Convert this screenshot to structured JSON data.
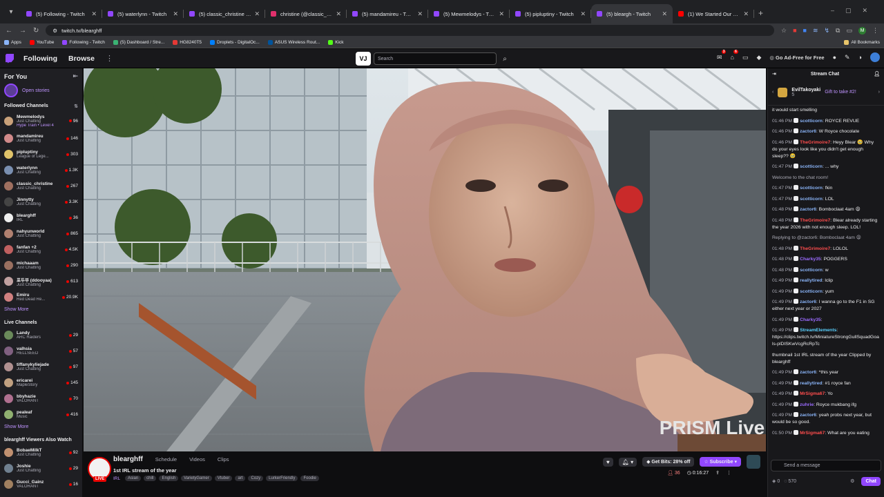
{
  "browser": {
    "tabs": [
      {
        "title": "(5) Following - Twitch",
        "color": "#9147ff"
      },
      {
        "title": "(5) waterlynn - Twitch",
        "color": "#9147ff"
      },
      {
        "title": "(5) classic_christine - Twitch",
        "color": "#9147ff"
      },
      {
        "title": "christine (@classic_christine) -",
        "color": "#e1306c"
      },
      {
        "title": "(5) mandamireu - Twitch",
        "color": "#9147ff"
      },
      {
        "title": "(5) Mewmelodys - Twitch",
        "color": "#9147ff"
      },
      {
        "title": "(5) pipluptiny - Twitch",
        "color": "#9147ff"
      },
      {
        "title": "(5) bleargh - Twitch",
        "color": "#9147ff",
        "active": true
      },
      {
        "title": "(1) We Started Our Own Food",
        "color": "#ff0000"
      }
    ],
    "url": "twitch.tv/blearghff",
    "bookmarks": [
      {
        "label": "Apps",
        "color": "#8ab4f8"
      },
      {
        "label": "YouTube",
        "color": "#ff0000"
      },
      {
        "label": "Following - Twitch",
        "color": "#9147ff"
      },
      {
        "label": "(5) Dashboard / Stre...",
        "color": "#3bb273"
      },
      {
        "label": "HG8240T5",
        "color": "#e53935"
      },
      {
        "label": "Droplets - DigitalOc...",
        "color": "#0080ff"
      },
      {
        "label": "ASUS Wireless Rout...",
        "color": "#00539b"
      },
      {
        "label": "Kick",
        "color": "#53fc18"
      }
    ],
    "all_bookmarks": "All Bookmarks",
    "profile_initial": "M"
  },
  "topnav": {
    "following": "Following",
    "browse": "Browse",
    "vj": "VJ",
    "search_placeholder": "Search",
    "notif_count_1": "3",
    "notif_count_2": "6",
    "ad_free": "Go Ad-Free for Free"
  },
  "sidebar": {
    "for_you": "For You",
    "open_stories": "Open stories",
    "followed_title": "Followed Channels",
    "followed": [
      {
        "name": "Mewmelodys",
        "sub": "Just Chatting",
        "extra": "Hype Train • Level 4",
        "count": "96",
        "color": "#c9a17a"
      },
      {
        "name": "mandamireu",
        "sub": "Just Chatting",
        "count": "146",
        "color": "#d18a8a"
      },
      {
        "name": "pipluptiny",
        "sub": "League of Lege...",
        "count": "303",
        "color": "#e0c36a"
      },
      {
        "name": "waterlynn",
        "sub": "Just Chatting",
        "count": "1.3K",
        "color": "#7a8fb0"
      },
      {
        "name": "classic_christine",
        "sub": "Just Chatting",
        "count": "267",
        "color": "#a07060"
      },
      {
        "name": "Jinnytty",
        "sub": "Just Chatting",
        "count": "3.3K",
        "color": "#444444"
      },
      {
        "name": "blearghff",
        "sub": "IRL",
        "count": "36",
        "color": "#eeeeee"
      },
      {
        "name": "nahyunworld",
        "sub": "Just Chatting",
        "count": "865",
        "color": "#b08070"
      },
      {
        "name": "fanfan +2",
        "sub": "Just Chatting",
        "count": "4.5K",
        "color": "#c06060"
      },
      {
        "name": "michaaam",
        "sub": "Just Chatting",
        "count": "290",
        "color": "#9a7060"
      },
      {
        "name": "포두부 (ddooyaa)",
        "sub": "Just Chatting",
        "count": "613",
        "color": "#c0a0a0"
      },
      {
        "name": "Emiru",
        "sub": "Red Dead Re...",
        "count": "20.9K",
        "color": "#d08080"
      }
    ],
    "show_more_1": "Show More",
    "live_title": "Live Channels",
    "live": [
      {
        "name": "Landy",
        "sub": "ARC Raiders",
        "count": "29",
        "color": "#6a8a5a"
      },
      {
        "name": "valhsia",
        "sub": "HELLSEED",
        "count": "57",
        "color": "#806080"
      },
      {
        "name": "tiffanykyliejade",
        "sub": "Just Chatting",
        "count": "97",
        "color": "#b09090"
      },
      {
        "name": "ericarei",
        "sub": "MapleStory",
        "count": "145",
        "color": "#c0a080"
      },
      {
        "name": "bbyhazie",
        "sub": "VALORANT",
        "count": "70",
        "color": "#b07090"
      },
      {
        "name": "pealeaf",
        "sub": "Music",
        "count": "416",
        "color": "#90b070"
      }
    ],
    "show_more_2": "Show More",
    "also_title": "blearghff Viewers Also Watch",
    "also": [
      {
        "name": "BobaeMilkT",
        "sub": "Just Chatting",
        "count": "92",
        "color": "#c09070"
      },
      {
        "name": "Joshie",
        "sub": "Just Chatting",
        "count": "29",
        "color": "#708090"
      },
      {
        "name": "Gucci_Gainz",
        "sub": "VALORANT",
        "count": "16",
        "color": "#a08060"
      }
    ]
  },
  "video": {
    "watermark": "PRISM Live"
  },
  "stream": {
    "channel": "blearghff",
    "title": "1st IRL stream of the year",
    "live": "LIVE",
    "schedule": "Schedule",
    "videos": "Videos",
    "clips": "Clips",
    "category": "IRL",
    "tags": [
      "Asian",
      "chill",
      "English",
      "VarietyGamer",
      "Vtuber",
      "art",
      "Cozy",
      "LurkerFriendly",
      "Foodie"
    ],
    "get_bits": "Get Bits: 28% off",
    "subscribe": "Subscribe",
    "viewers": "36",
    "uptime": "0:16:27"
  },
  "chat": {
    "title": "Stream Chat",
    "pinned_user": "EvilTakoyaki",
    "pinned_count": "5",
    "pinned_gift": "Gift to take #2!",
    "messages": [
      {
        "t": "",
        "u": "",
        "c": "#efeff1",
        "m": "it would start smelling"
      },
      {
        "t": "01:46 PM",
        "u": "scotticorn",
        "c": "#8ab4f8",
        "m": ": ROYCE REVUE"
      },
      {
        "t": "01:46 PM",
        "u": "zactor6",
        "c": "#8ab4f8",
        "m": ": W Royce chocolate"
      },
      {
        "t": "01:46 PM",
        "u": "TheGrimoire7",
        "c": "#ff4d4d",
        "m": ": Heyy Blear 🥹 Why do your eyes look like you didn't get enough sleep?? 🥹"
      },
      {
        "t": "01:47 PM",
        "u": "scotticorn",
        "c": "#8ab4f8",
        "m": ": ... why"
      },
      {
        "t": "",
        "u": "",
        "c": "#adadb8",
        "m": "Welcome to the chat room!"
      },
      {
        "t": "01:47 PM",
        "u": "scotticorn",
        "c": "#8ab4f8",
        "m": ": fkin"
      },
      {
        "t": "01:47 PM",
        "u": "scotticorn",
        "c": "#8ab4f8",
        "m": ": LOL"
      },
      {
        "t": "01:48 PM",
        "u": "zactor6",
        "c": "#8ab4f8",
        "m": ": Bomboclaat 4am 😩"
      },
      {
        "t": "01:48 PM",
        "u": "TheGrimoire7",
        "c": "#ff4d4d",
        "m": ": Blear already starting the year 2026 with not enough sleep. LOL!"
      },
      {
        "t": "",
        "u": "",
        "c": "#adadb8",
        "m": "Replying to @zactor6: Bomboclaat 4am 😩"
      },
      {
        "t": "01:48 PM",
        "u": "TheGrimoire7",
        "c": "#ff4d4d",
        "m": ": LOLOL"
      },
      {
        "t": "01:48 PM",
        "u": "Charky35",
        "c": "#9b6bff",
        "m": ": POGGERS"
      },
      {
        "t": "01:48 PM",
        "u": "scotticorn",
        "c": "#8ab4f8",
        "m": ": w"
      },
      {
        "t": "01:49 PM",
        "u": "reallytired",
        "c": "#8ab4f8",
        "m": ": lclip"
      },
      {
        "t": "01:49 PM",
        "u": "scotticorn",
        "c": "#8ab4f8",
        "m": ": yum"
      },
      {
        "t": "01:49 PM",
        "u": "zactor6",
        "c": "#8ab4f8",
        "m": ": I wanna go to the F1 in SG either next year or 2027"
      },
      {
        "t": "01:49 PM",
        "u": "Charky35",
        "c": "#9b6bff",
        "m": ":"
      },
      {
        "t": "01:49 PM",
        "u": "StreamElements",
        "c": "#5ad1ff",
        "m": ": https://clips.twitch.tv/MiniatureStrongGullSquadGoals-plDISKwVcgRcRpTc"
      },
      {
        "t": "",
        "u": "",
        "c": "#efeff1",
        "m": "thumbnail  1st IRL stream of the year  Clipped by blearghff"
      },
      {
        "t": "01:49 PM",
        "u": "zactor6",
        "c": "#8ab4f8",
        "m": ": *this year"
      },
      {
        "t": "01:49 PM",
        "u": "reallytired",
        "c": "#8ab4f8",
        "m": ": #1 royce fan"
      },
      {
        "t": "01:49 PM",
        "u": "MrSigma67",
        "c": "#ff4d4d",
        "m": ": Yo"
      },
      {
        "t": "01:49 PM",
        "u": "zuhrie",
        "c": "#9b6bff",
        "m": ": Royce mukbang ifg"
      },
      {
        "t": "01:49 PM",
        "u": "zactor6",
        "c": "#8ab4f8",
        "m": ": yeah probs next year, but would be so good."
      },
      {
        "t": "01:50 PM",
        "u": "MrSigma67",
        "c": "#ff4d4d",
        "m": ": What are you eating"
      }
    ],
    "input_placeholder": "Send a message",
    "points_a": "0",
    "points_b": "570",
    "chat_button": "Chat"
  }
}
